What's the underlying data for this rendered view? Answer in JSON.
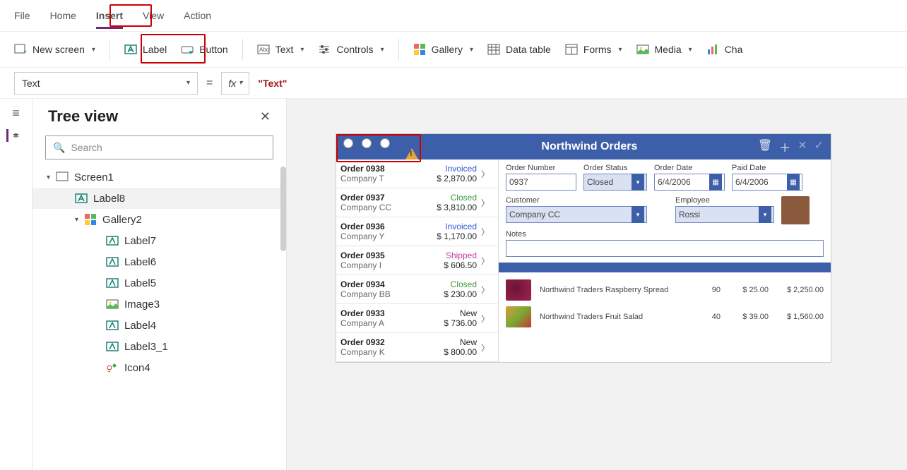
{
  "menu": {
    "file": "File",
    "home": "Home",
    "insert": "Insert",
    "view": "View",
    "action": "Action",
    "active": "insert"
  },
  "ribbon": {
    "new_screen": "New screen",
    "label": "Label",
    "button": "Button",
    "text": "Text",
    "controls": "Controls",
    "gallery": "Gallery",
    "data_table": "Data table",
    "forms": "Forms",
    "media": "Media",
    "chart": "Cha"
  },
  "formula": {
    "property": "Text",
    "equals": "=",
    "fx": "fx",
    "value": "\"Text\""
  },
  "panel": {
    "title": "Tree view",
    "search_placeholder": "Search"
  },
  "tree": {
    "screen": "Screen1",
    "label8": "Label8",
    "gallery2": "Gallery2",
    "label7": "Label7",
    "label6": "Label6",
    "label5": "Label5",
    "image3": "Image3",
    "label4": "Label4",
    "label3_1": "Label3_1",
    "icon4": "Icon4"
  },
  "app": {
    "title": "Northwind Orders"
  },
  "orders": [
    {
      "num": "Order 0938",
      "company": "Company T",
      "status": "Invoiced",
      "status_cls": "invoiced",
      "amount": "$ 2,870.00"
    },
    {
      "num": "Order 0937",
      "company": "Company CC",
      "status": "Closed",
      "status_cls": "closed",
      "amount": "$ 3,810.00"
    },
    {
      "num": "Order 0936",
      "company": "Company Y",
      "status": "Invoiced",
      "status_cls": "invoiced",
      "amount": "$ 1,170.00"
    },
    {
      "num": "Order 0935",
      "company": "Company I",
      "status": "Shipped",
      "status_cls": "shipped",
      "amount": "$ 606.50"
    },
    {
      "num": "Order 0934",
      "company": "Company BB",
      "status": "Closed",
      "status_cls": "closed",
      "amount": "$ 230.00"
    },
    {
      "num": "Order 0933",
      "company": "Company A",
      "status": "New",
      "status_cls": "new",
      "amount": "$ 736.00"
    },
    {
      "num": "Order 0932",
      "company": "Company K",
      "status": "New",
      "status_cls": "new",
      "amount": "$ 800.00"
    }
  ],
  "detail": {
    "order_number_lbl": "Order Number",
    "order_number": "0937",
    "order_status_lbl": "Order Status",
    "order_status": "Closed",
    "order_date_lbl": "Order Date",
    "order_date": "6/4/2006",
    "paid_date_lbl": "Paid Date",
    "paid_date": "6/4/2006",
    "customer_lbl": "Customer",
    "customer": "Company CC",
    "employee_lbl": "Employee",
    "employee": "Rossi",
    "notes_lbl": "Notes"
  },
  "lines": [
    {
      "name": "Northwind Traders Raspberry Spread",
      "qty": "90",
      "price": "$ 25.00",
      "total": "$ 2,250.00",
      "cls": "a"
    },
    {
      "name": "Northwind Traders Fruit Salad",
      "qty": "40",
      "price": "$ 39.00",
      "total": "$ 1,560.00",
      "cls": "b"
    }
  ]
}
